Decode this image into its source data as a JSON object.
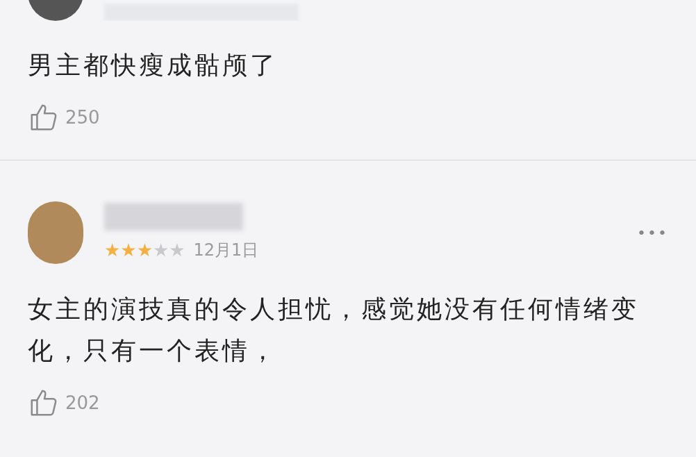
{
  "comments": [
    {
      "kind": "cut",
      "text": "男主都快瘦成骷颅了",
      "likes": "250"
    },
    {
      "kind": "full",
      "stars": 3,
      "date": "12月1日",
      "more": "•••",
      "text": "女主的演技真的令人担忧，感觉她没有任何情绪变化，只有一个表情，",
      "likes": "202"
    }
  ]
}
